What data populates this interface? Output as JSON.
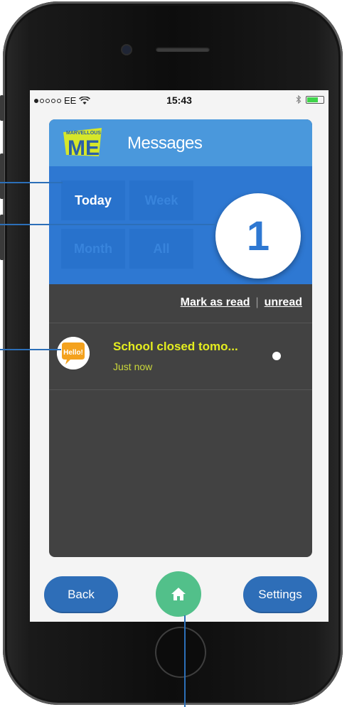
{
  "status_bar": {
    "carrier": "EE",
    "time": "15:43"
  },
  "header": {
    "logo_text_top": "MARVELLOUS",
    "logo_text_main": "ME",
    "title": "Messages"
  },
  "filters": {
    "today": "Today",
    "week": "Week",
    "month": "Month",
    "all": "All",
    "selected": "Today"
  },
  "message_count": "1",
  "mark": {
    "read": "Mark as read",
    "separator": "|",
    "unread": "unread"
  },
  "messages": [
    {
      "title": "School closed tomo...",
      "time": "Just now",
      "avatar_text": "Hello!"
    }
  ],
  "bottom_bar": {
    "back": "Back",
    "settings": "Settings"
  },
  "colors": {
    "header_blue": "#4a98dc",
    "filter_blue": "#2e78d2",
    "dark_panel": "#424242",
    "message_title": "#e4ed1f",
    "home_green": "#52c08a",
    "button_blue": "#2e6eb8"
  },
  "icons": {
    "wifi": "wifi-icon",
    "bluetooth": "bluetooth-icon",
    "battery": "battery-icon",
    "home": "home-icon"
  }
}
